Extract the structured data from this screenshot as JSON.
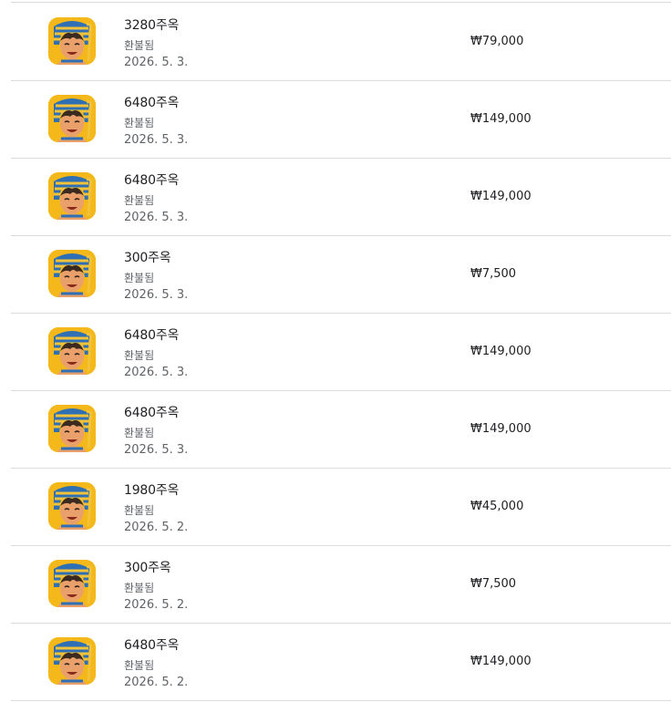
{
  "purchases": [
    {
      "name": "3280주옥",
      "status": "환불됨",
      "date": "2026. 5. 3.",
      "price": "₩79,000"
    },
    {
      "name": "6480주옥",
      "status": "환불됨",
      "date": "2026. 5. 3.",
      "price": "₩149,000"
    },
    {
      "name": "6480주옥",
      "status": "환불됨",
      "date": "2026. 5. 3.",
      "price": "₩149,000"
    },
    {
      "name": "300주옥",
      "status": "환불됨",
      "date": "2026. 5. 3.",
      "price": "₩7,500"
    },
    {
      "name": "6480주옥",
      "status": "환불됨",
      "date": "2026. 5. 3.",
      "price": "₩149,000"
    },
    {
      "name": "6480주옥",
      "status": "환불됨",
      "date": "2026. 5. 3.",
      "price": "₩149,000"
    },
    {
      "name": "1980주옥",
      "status": "환불됨",
      "date": "2026. 5. 2.",
      "price": "₩45,000"
    },
    {
      "name": "300주옥",
      "status": "환불됨",
      "date": "2026. 5. 2.",
      "price": "₩7,500"
    },
    {
      "name": "6480주옥",
      "status": "환불됨",
      "date": "2026. 5. 2.",
      "price": "₩149,000"
    }
  ],
  "icon": {
    "name": "game-app-icon",
    "bg": "#f4b81a",
    "headdress_blue": "#2f6fb3",
    "headdress_gold": "#f2c23a",
    "skin": "#e9a06b",
    "hair": "#3a2a20"
  }
}
